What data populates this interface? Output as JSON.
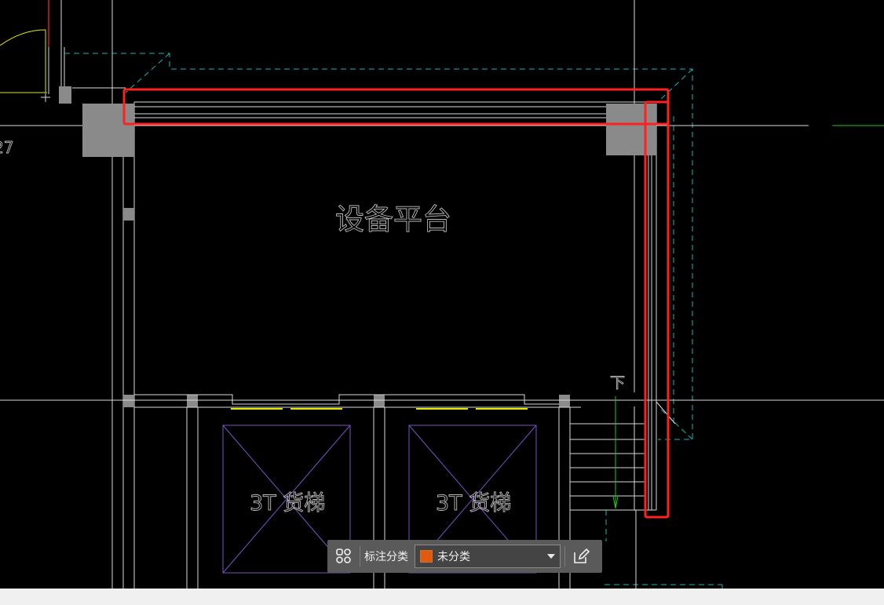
{
  "drawing": {
    "room_label": "设备平台",
    "elevator_left_label": "3T 货梯",
    "elevator_right_label": "3T 货梯",
    "stair_direction_label": "下",
    "edge_number_label": "27"
  },
  "toolbar": {
    "category_label": "标注分类",
    "selected_category": "未分类",
    "selected_category_color": "#e05a10"
  },
  "colors": {
    "background": "#000000",
    "wall_lines": "#d8d8d8",
    "dashed_outline": "#19b5b5",
    "highlight_box": "#ff2020",
    "column_fill": "#8a8a8a",
    "elevator_lines": "#7a4fc0",
    "door_marks": "#e6e600",
    "green_mark": "#21c021"
  },
  "icons": {
    "layout_button": "grid-cluster-icon",
    "edit_button": "edit-note-icon",
    "dropdown": "chevron-down-icon"
  }
}
